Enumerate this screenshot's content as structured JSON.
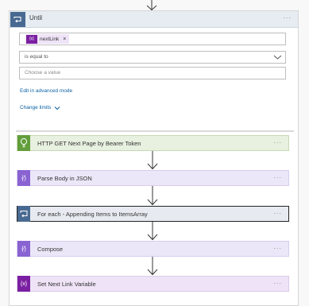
{
  "until": {
    "title": "Until",
    "menu": "···",
    "token": {
      "icon_text": "{x}",
      "label": "nextLink",
      "remove": "×"
    },
    "operator": "is equal to",
    "value_placeholder": "Choose a value",
    "edit_advanced": "Edit in advanced mode",
    "change_limits": "Change limits"
  },
  "actions": [
    {
      "label": "HTTP GET Next Page by Bearer Token",
      "icon": "lightbulb-icon",
      "menu": "···"
    },
    {
      "label": "Parse Body in JSON",
      "icon": "variable-braces-icon",
      "icon_text": "{⁄}",
      "menu": "···"
    },
    {
      "label": "For each - Appending Items to ItemsArray",
      "icon": "loop-icon",
      "menu": "···"
    },
    {
      "label": "Compose",
      "icon": "compose-braces-icon",
      "icon_text": "{⁄}",
      "menu": "···"
    },
    {
      "label": "Set Next Link Variable",
      "icon": "variable-icon",
      "icon_text": "{x}",
      "menu": "···"
    }
  ],
  "colors": {
    "control": "#486991",
    "http": "#629e3a",
    "data_operations": "#8a63d2",
    "variables": "#7b1fa2",
    "link": "#0b61a4"
  }
}
